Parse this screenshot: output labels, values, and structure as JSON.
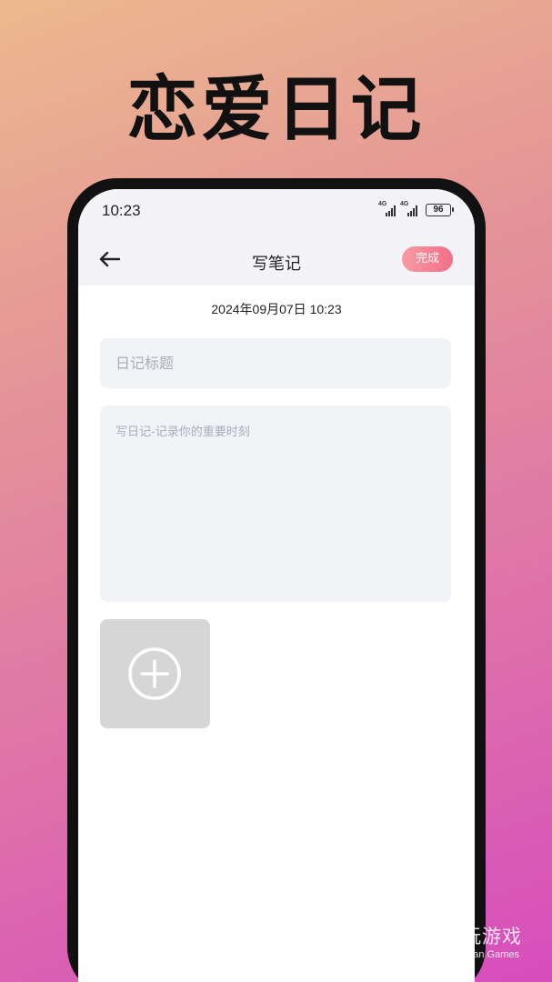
{
  "promo": {
    "title": "恋爱日记"
  },
  "status_bar": {
    "time": "10:23",
    "network_1": "4G",
    "network_2": "4G",
    "battery": "96"
  },
  "nav": {
    "title": "写笔记",
    "done_label": "完成",
    "back_icon": "arrow-left-icon"
  },
  "editor": {
    "date": "2024年09月07日 10:23",
    "title_placeholder": "日记标题",
    "content_placeholder": "写日记-记录你的重要时刻",
    "add_photo_icon": "plus-circle-icon"
  },
  "watermark": {
    "name_cn": "仍玩游戏",
    "name_en": "Rengwan Games"
  }
}
